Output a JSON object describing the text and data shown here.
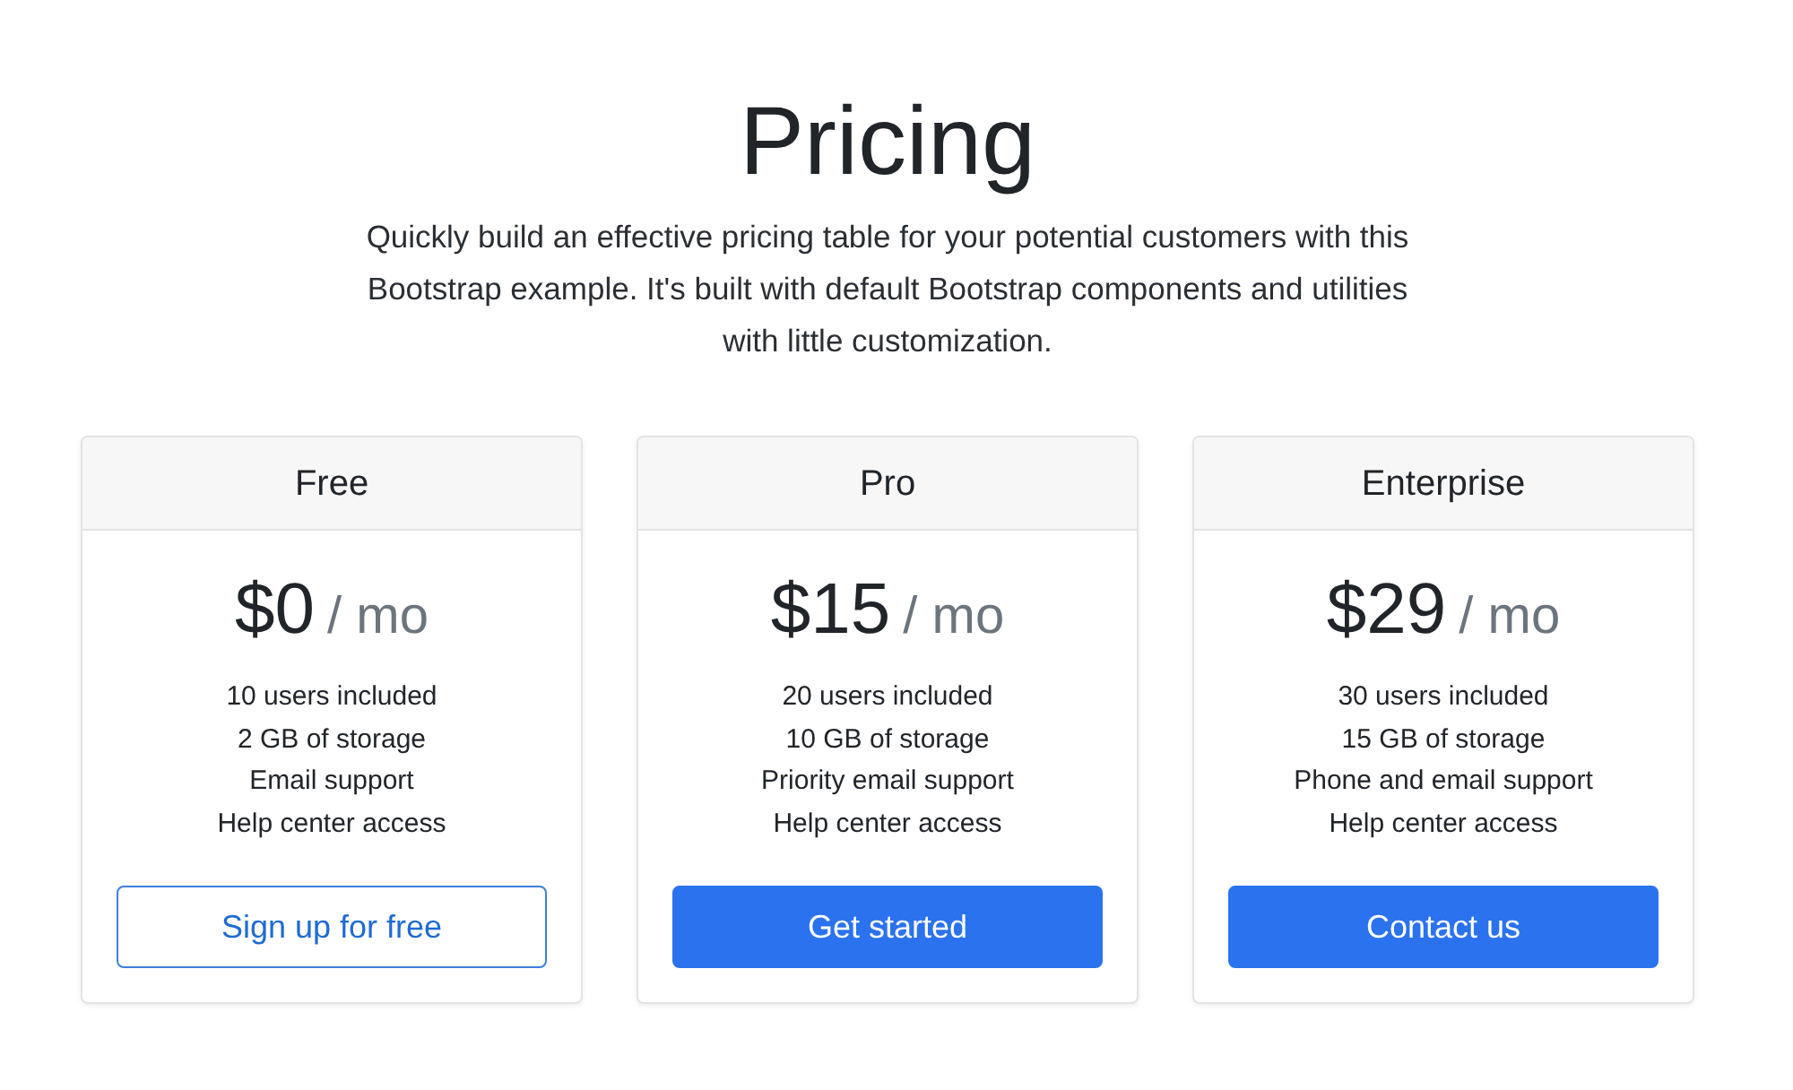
{
  "header": {
    "title": "Pricing",
    "lead": "Quickly build an effective pricing table for your potential customers with this Bootstrap example. It's built with default Bootstrap components and utilities with little customization."
  },
  "plans": [
    {
      "name": "Free",
      "price": "$0",
      "period": "/ mo",
      "features": [
        "10 users included",
        "2 GB of storage",
        "Email support",
        "Help center access"
      ],
      "button": {
        "label": "Sign up for free",
        "kind": "outline"
      }
    },
    {
      "name": "Pro",
      "price": "$15",
      "period": "/ mo",
      "features": [
        "20 users included",
        "10 GB of storage",
        "Priority email support",
        "Help center access"
      ],
      "button": {
        "label": "Get started",
        "kind": "primary"
      }
    },
    {
      "name": "Enterprise",
      "price": "$29",
      "period": "/ mo",
      "features": [
        "30 users included",
        "15 GB of storage",
        "Phone and email support",
        "Help center access"
      ],
      "button": {
        "label": "Contact us",
        "kind": "primary"
      }
    }
  ]
}
